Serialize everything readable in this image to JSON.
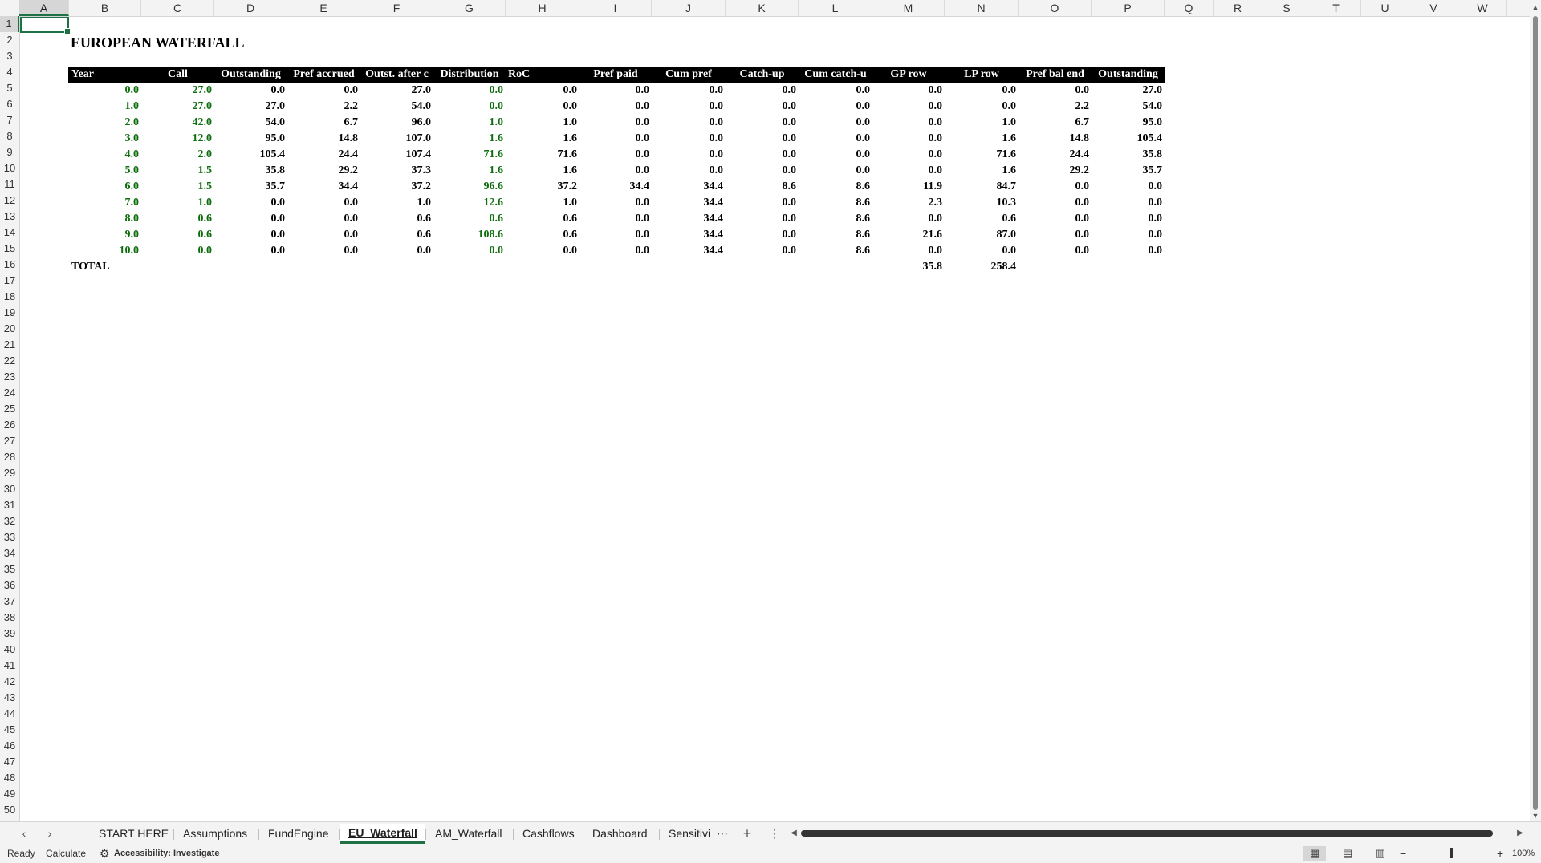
{
  "columns": [
    "A",
    "B",
    "C",
    "D",
    "E",
    "F",
    "G",
    "H",
    "I",
    "J",
    "K",
    "L",
    "M",
    "N",
    "O",
    "P",
    "Q",
    "R",
    "S",
    "T",
    "U",
    "V",
    "W"
  ],
  "selected_column": "A",
  "selected_row": "1",
  "row_numbers": [
    "1",
    "2",
    "3",
    "4",
    "5",
    "6",
    "7",
    "8",
    "9",
    "10",
    "11",
    "12",
    "13",
    "14",
    "15",
    "16",
    "17",
    "18",
    "19",
    "20",
    "21",
    "22",
    "23",
    "24",
    "25",
    "26",
    "27",
    "28",
    "29",
    "30",
    "31",
    "32",
    "33",
    "34",
    "35",
    "36",
    "37",
    "38",
    "39",
    "40",
    "41",
    "42",
    "43",
    "44",
    "45",
    "46",
    "47",
    "48",
    "49",
    "50"
  ],
  "sheet": {
    "title": "EUROPEAN WATERFALL",
    "headers": [
      "Year",
      "Call",
      "Outstanding",
      "Pref accrued",
      "Outst. after c",
      "Distribution",
      "RoC",
      "Pref paid",
      "Cum pref",
      "Catch-up",
      "Cum catch-u",
      "GP row",
      "LP row",
      "Pref bal end",
      "Outstanding"
    ],
    "rows": [
      [
        "0.0",
        "27.0",
        "0.0",
        "0.0",
        "27.0",
        "0.0",
        "0.0",
        "0.0",
        "0.0",
        "0.0",
        "0.0",
        "0.0",
        "0.0",
        "0.0",
        "27.0"
      ],
      [
        "1.0",
        "27.0",
        "27.0",
        "2.2",
        "54.0",
        "0.0",
        "0.0",
        "0.0",
        "0.0",
        "0.0",
        "0.0",
        "0.0",
        "0.0",
        "2.2",
        "54.0"
      ],
      [
        "2.0",
        "42.0",
        "54.0",
        "6.7",
        "96.0",
        "1.0",
        "1.0",
        "0.0",
        "0.0",
        "0.0",
        "0.0",
        "0.0",
        "1.0",
        "6.7",
        "95.0"
      ],
      [
        "3.0",
        "12.0",
        "95.0",
        "14.8",
        "107.0",
        "1.6",
        "1.6",
        "0.0",
        "0.0",
        "0.0",
        "0.0",
        "0.0",
        "1.6",
        "14.8",
        "105.4"
      ],
      [
        "4.0",
        "2.0",
        "105.4",
        "24.4",
        "107.4",
        "71.6",
        "71.6",
        "0.0",
        "0.0",
        "0.0",
        "0.0",
        "0.0",
        "71.6",
        "24.4",
        "35.8"
      ],
      [
        "5.0",
        "1.5",
        "35.8",
        "29.2",
        "37.3",
        "1.6",
        "1.6",
        "0.0",
        "0.0",
        "0.0",
        "0.0",
        "0.0",
        "1.6",
        "29.2",
        "35.7"
      ],
      [
        "6.0",
        "1.5",
        "35.7",
        "34.4",
        "37.2",
        "96.6",
        "37.2",
        "34.4",
        "34.4",
        "8.6",
        "8.6",
        "11.9",
        "84.7",
        "0.0",
        "0.0"
      ],
      [
        "7.0",
        "1.0",
        "0.0",
        "0.0",
        "1.0",
        "12.6",
        "1.0",
        "0.0",
        "34.4",
        "0.0",
        "8.6",
        "2.3",
        "10.3",
        "0.0",
        "0.0"
      ],
      [
        "8.0",
        "0.6",
        "0.0",
        "0.0",
        "0.6",
        "0.6",
        "0.6",
        "0.0",
        "34.4",
        "0.0",
        "8.6",
        "0.0",
        "0.6",
        "0.0",
        "0.0"
      ],
      [
        "9.0",
        "0.6",
        "0.0",
        "0.0",
        "0.6",
        "108.6",
        "0.6",
        "0.0",
        "34.4",
        "0.0",
        "8.6",
        "21.6",
        "87.0",
        "0.0",
        "0.0"
      ],
      [
        "10.0",
        "0.0",
        "0.0",
        "0.0",
        "0.0",
        "0.0",
        "0.0",
        "0.0",
        "34.4",
        "0.0",
        "8.6",
        "0.0",
        "0.0",
        "0.0",
        "0.0"
      ]
    ],
    "green_columns": [
      0,
      1,
      5
    ],
    "total_label": "TOTAL",
    "total_gp": "35.8",
    "total_lp": "258.4"
  },
  "tabs": [
    "START HERE",
    "Assumptions",
    "FundEngine",
    "EU_Waterfall",
    "AM_Waterfall",
    "Cashflows",
    "Dashboard",
    "Sensitivi"
  ],
  "active_tab": "EU_Waterfall",
  "status": {
    "ready": "Ready",
    "calculate": "Calculate",
    "accessibility": "Accessibility: Investigate",
    "zoom": "100%"
  },
  "colors": {
    "accent": "#1e7145",
    "green_text": "#0e6e0e",
    "header_bg": "#000000"
  }
}
